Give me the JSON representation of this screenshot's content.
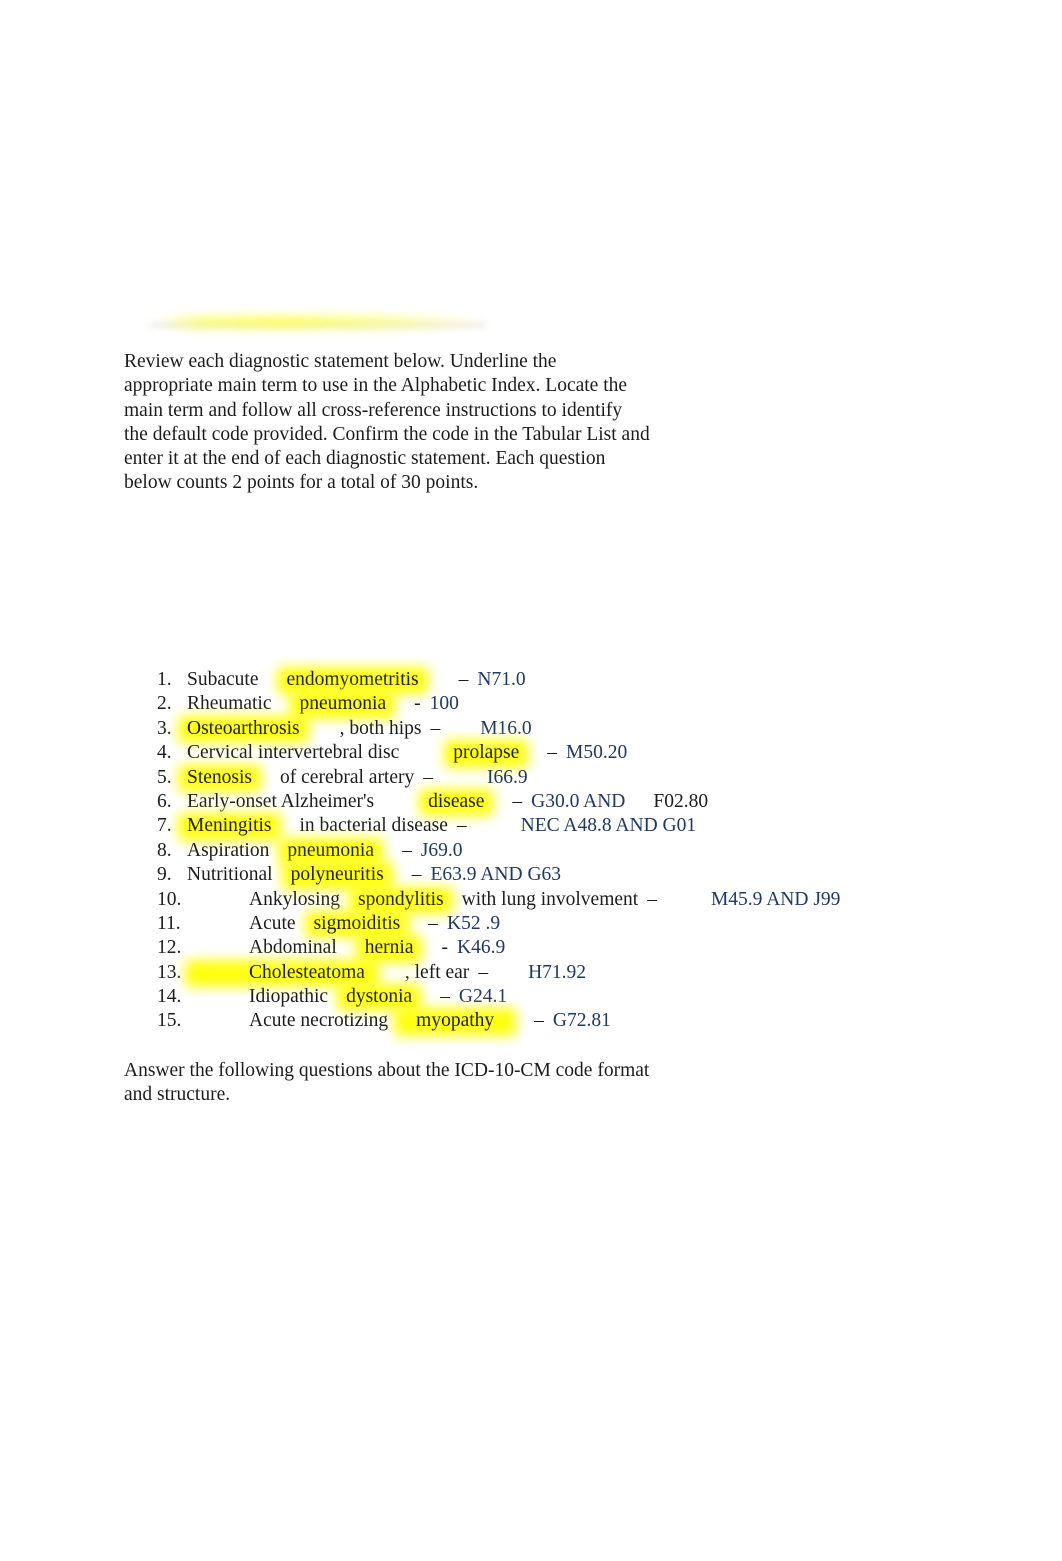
{
  "document": {
    "type": "worksheet",
    "background_color": "#ffffff",
    "text_color": "#1c1c1c",
    "code_color": "#1f3864",
    "highlight_color": "#ffff00"
  },
  "intro_paragraph": "Review each diagnostic statement below. Underline the\nappropriate main term to use in the Alphabetic Index. Locate the\nmain term and follow all cross-reference instructions to identify\nthe default code provided. Confirm the code in the Tabular List and\nenter it at the end of each diagnostic statement. Each question\nbelow counts 2 points for a total of 30 points.",
  "closing_paragraph": "Answer the following questions about the ICD-10-CM code format\nand structure.",
  "questions": [
    {
      "number": "1.",
      "pre": "Subacute",
      "term": "endomyometritis",
      "post": "",
      "dash": "–",
      "code": "N71.0",
      "code2": ""
    },
    {
      "number": "2.",
      "pre": "Rheumatic",
      "term": "pneumonia",
      "post": "",
      "dash": "-",
      "code": "100",
      "code2": ""
    },
    {
      "number": "3.",
      "pre": "",
      "term": "Osteoarthrosis",
      "post": ", both hips",
      "dash": "–",
      "code": "M16.0",
      "code2": ""
    },
    {
      "number": "4.",
      "pre": "Cervical intervertebral disc",
      "term": "prolapse",
      "post": "",
      "dash": "–",
      "code": "M50.20",
      "code2": ""
    },
    {
      "number": "5.",
      "pre": "",
      "term": "Stenosis",
      "post": "of cerebral artery",
      "dash": "–",
      "code": "I66.9",
      "code2": ""
    },
    {
      "number": "6.",
      "pre": "Early-onset Alzheimer's",
      "term": "disease",
      "post": "",
      "dash": "–",
      "code": "G30.0 AND",
      "code2": "F02.80"
    },
    {
      "number": "7.",
      "pre": "",
      "term": "Meningitis",
      "post": "in bacterial disease",
      "dash": "–",
      "code": "NEC A48.8 AND G01",
      "code2": ""
    },
    {
      "number": "8.",
      "pre": "Aspiration",
      "term": "pneumonia",
      "post": "",
      "dash": "–",
      "code": "J69.0",
      "code2": ""
    },
    {
      "number": "9.",
      "pre": "Nutritional",
      "term": "polyneuritis",
      "post": "",
      "dash": "–",
      "code": "E63.9 AND G63",
      "code2": ""
    },
    {
      "number": "10.",
      "pre": "Ankylosing",
      "term": "spondylitis",
      "post": "with lung involvement",
      "dash": "–",
      "code": "M45.9 AND J99",
      "code2": ""
    },
    {
      "number": "11.",
      "pre": "Acute",
      "term": "sigmoiditis",
      "post": "",
      "dash": "–",
      "code": "K52 .9",
      "code2": ""
    },
    {
      "number": "12.",
      "pre": "Abdominal",
      "term": "hernia",
      "post": "",
      "dash": "-",
      "code": "K46.9",
      "code2": ""
    },
    {
      "number": "13.",
      "pre": "",
      "term": "Cholesteatoma",
      "post": ", left ear",
      "dash": "–",
      "code": "H71.92",
      "code2": ""
    },
    {
      "number": "14.",
      "pre": "Idiopathic",
      "term": "dystonia",
      "post": "",
      "dash": "–",
      "code": "G24.1",
      "code2": ""
    },
    {
      "number": "15.",
      "pre": "Acute   necrotizing",
      "term": "myopathy",
      "post": "",
      "dash": "–",
      "code": "G72.81",
      "code2": ""
    }
  ]
}
